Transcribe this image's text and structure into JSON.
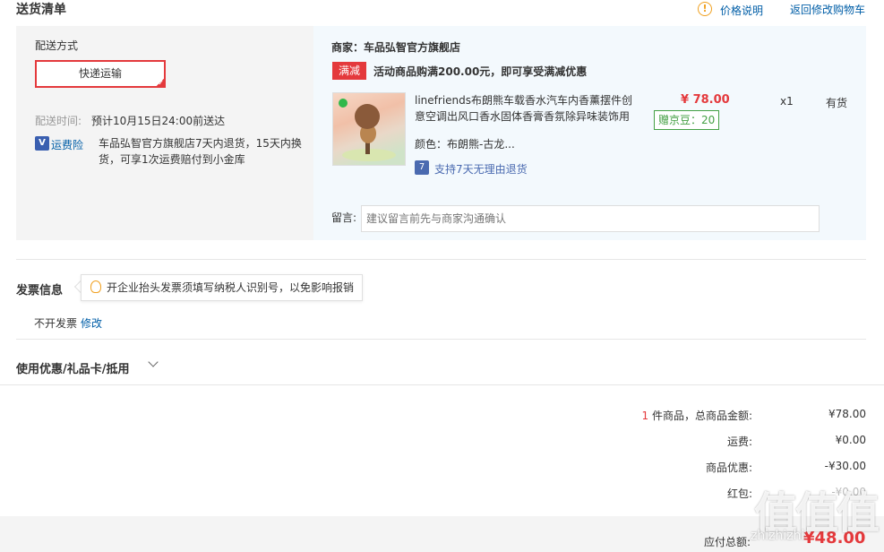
{
  "header": {
    "title": "送货清单",
    "price_explain": "价格说明",
    "back_to_cart": "返回修改购物车"
  },
  "delivery": {
    "label": "配送方式",
    "method": "快递运输",
    "time_label": "配送时间:",
    "time_value": "预计10月15日24:00前送达",
    "insurance_label": "运费险",
    "insurance_text": "车品弘智官方旗舰店7天内退货，15天内换货，可享1次运费赔付到小金库"
  },
  "merchant": {
    "name": "商家：车品弘智官方旗舰店",
    "promo_badge": "满减",
    "promo_text": "活动商品购满200.00元，即可享受满减优惠"
  },
  "product": {
    "name": "linefriends布朗熊车载香水汽车内香薰摆件创意空调出风口香水固体香膏香氛除异味装饰用",
    "price": "¥ 78.00",
    "beans": "赠京豆：20",
    "qty": "x1",
    "stock": "有货",
    "color": "颜色：布朗熊-古龙...",
    "return_policy": "支持7天无理由退货"
  },
  "note": {
    "label": "留言:",
    "placeholder": "建议留言前先与商家沟通确认"
  },
  "invoice": {
    "title": "发票信息",
    "tip": "开企业抬头发票须填写纳税人识别号，以免影响报销",
    "status": "不开发票",
    "modify": "修改"
  },
  "coupon": {
    "title": "使用优惠/礼品卡/抵用"
  },
  "summary": {
    "count": "1",
    "total_label": " 件商品，总商品金额:",
    "total_value": "¥78.00",
    "shipping_label": "运费:",
    "shipping_value": "¥0.00",
    "discount_label": "商品优惠:",
    "discount_value": "-¥30.00",
    "redpack_label": "红包:",
    "redpack_value": "-¥0.00",
    "pay_label": "应付总额:",
    "pay_value": "¥48.00"
  },
  "watermark": {
    "logo": "值值值",
    "site": "zhizhizhi"
  },
  "colors": {
    "accent_red": "#e4393c",
    "link_blue": "#005ea7",
    "beans_green": "#44a044"
  }
}
